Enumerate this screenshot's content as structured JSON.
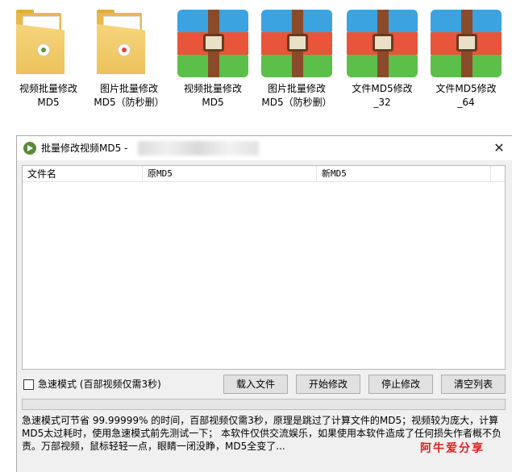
{
  "desktop": {
    "icons": [
      {
        "type": "folder",
        "badge": "green",
        "label_line1": "视频批量修改",
        "label_line2": "MD5"
      },
      {
        "type": "folder",
        "badge": "red",
        "label_line1": "图片批量修改",
        "label_line2": "MD5（防秒删）"
      },
      {
        "type": "archive",
        "label_line1": "视频批量修改",
        "label_line2": "MD5"
      },
      {
        "type": "archive",
        "label_line1": "图片批量修改",
        "label_line2": "MD5（防秒删）"
      },
      {
        "type": "archive",
        "label_line1": "文件MD5修改",
        "label_line2": "_32"
      },
      {
        "type": "archive",
        "label_line1": "文件MD5修改",
        "label_line2": "_64"
      }
    ]
  },
  "window": {
    "title": "批量修改视频MD5 -",
    "close_glyph": "✕",
    "list": {
      "columns": [
        "文件名",
        "原MD5",
        "新MD5"
      ],
      "rows": []
    },
    "fast_mode_label": "急速模式 (百部视频仅需3秒)",
    "fast_mode_checked": false,
    "buttons": {
      "import": "载入文件",
      "start": "开始修改",
      "stop": "停止修改",
      "clear": "清空列表"
    },
    "progress_fraction": 0,
    "description": "急速模式可节省 99.99999% 的时间，百部视频仅需3秒，原理是跳过了计算文件的MD5；视频较为庞大，计算MD5太过耗时，使用急速模式前先测试一下； 本软件仅供交流娱乐，如果使用本软件造成了任何损失作者概不负责。万部视频，鼠标轻轻一点，眼睛一闭没睁，MD5全变了...",
    "watermark": "阿牛爱分享"
  },
  "colors": {
    "folder": "#e8b84a",
    "rar_blue": "#3aa3e0",
    "rar_red": "#e8553a",
    "rar_green": "#5bbf4a",
    "watermark": "#e02020"
  }
}
